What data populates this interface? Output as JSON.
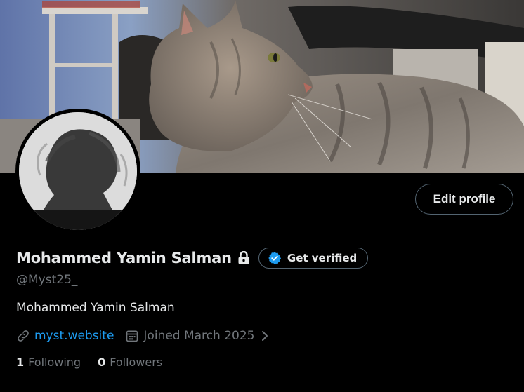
{
  "profile": {
    "display_name": "Mohammed Yamin Salman",
    "handle": "@Myst25_",
    "bio": "Mohammed Yamin Salman",
    "website": "myst.website",
    "joined": "Joined March 2025",
    "following_count": "1",
    "following_label": "Following",
    "followers_count": "0",
    "followers_label": "Followers"
  },
  "buttons": {
    "edit_profile": "Edit profile",
    "get_verified": "Get verified"
  },
  "icons": {
    "lock": "lock-icon",
    "verified_badge": "verified-badge-icon",
    "link": "link-icon",
    "calendar": "calendar-icon",
    "chevron": "chevron-right-icon"
  },
  "colors": {
    "background": "#000000",
    "text_primary": "#e7e9ea",
    "text_secondary": "#71767b",
    "accent": "#1d9bf0",
    "border": "#536471"
  }
}
